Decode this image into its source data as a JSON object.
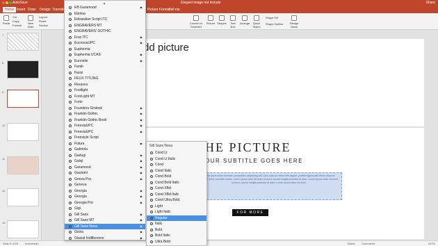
{
  "titlebar": {
    "app": "AutoSave",
    "doc": "Elegant image not include",
    "share": "Share"
  },
  "tabs": [
    "File",
    "Home",
    "Insert",
    "Draw",
    "Design",
    "Transitions",
    "Animations",
    "Slide Show",
    "Review",
    "View",
    "Tell me"
  ],
  "ribbon": {
    "paste": "Paste",
    "cut": "Cut",
    "copy": "Copy",
    "format": "Format",
    "new_slide": "New Slide",
    "layout": "Layout",
    "reset": "Reset",
    "section": "Section",
    "convert": "Convert to SmartArt",
    "picture": "Picture",
    "shapes": "Shapes",
    "textbox": "Text Box",
    "arrange": "Arrange",
    "quick_styles": "Quick Styles",
    "shape_fill": "Shape Fill",
    "shape_outline": "Shape Outline",
    "design_ideas": "Design Ideas",
    "picture_format": "Picture Format",
    "tell_me": "Tell me"
  },
  "thumbs": [
    "7",
    "8",
    "9",
    "10",
    "11",
    "12",
    "13"
  ],
  "slide1": {
    "title": "dd picture"
  },
  "slide2": {
    "title": "HE PICTURE",
    "subtitle": "OUR SUBTITLE GOES HERE",
    "body": "Lorem ipsum dolor sit amet, consectetur adipiscing elit. Quis nulla ac netus nibh aliquet, porttitor ligula justo libero vivamus porttitor dolor, convallis mattis. Lorem ipsum dolor sit amet, luctus in auctor fringilla pharetra at diam. Lorem ipsum dolor sit amet, luctus in auctor fringilla pharetra at diam. Lorem ipsum dolor sit amet.",
    "button": "FOR MORE"
  },
  "fontmenu": {
    "items": [
      {
        "label": "EB Garamond",
        "arrow": true
      },
      {
        "label": "Ebrima",
        "arrow": false
      },
      {
        "label": "Edwardian Script ITC",
        "arrow": false
      },
      {
        "label": "ENGRAVERS MT",
        "arrow": false
      },
      {
        "label": "ENGRAVERS' GOTHIC",
        "arrow": false
      },
      {
        "label": "Eras ITC",
        "arrow": true
      },
      {
        "label": "EucrosiaUPC",
        "arrow": true
      },
      {
        "label": "Euphemia",
        "arrow": false
      },
      {
        "label": "Euphemia UCAS",
        "arrow": true
      },
      {
        "label": "Eurostile",
        "arrow": true
      },
      {
        "label": "Farah",
        "arrow": false
      },
      {
        "label": "Farisi",
        "arrow": false
      },
      {
        "label": "FELIX TITLING",
        "arrow": false
      },
      {
        "label": "Fleurons",
        "arrow": false
      },
      {
        "label": "Footlight",
        "arrow": false
      },
      {
        "label": "ForeLight MT",
        "arrow": false
      },
      {
        "label": "Forte",
        "arrow": false
      },
      {
        "label": "Founders Grotesk",
        "arrow": true
      },
      {
        "label": "Franklin Gothic",
        "arrow": true
      },
      {
        "label": "Franklin Gothic Book",
        "arrow": true
      },
      {
        "label": "FreesiaUPC",
        "arrow": true
      },
      {
        "label": "FreesiaUPC",
        "arrow": true
      },
      {
        "label": "Freestyle Script",
        "arrow": false
      },
      {
        "label": "Futura",
        "arrow": true
      },
      {
        "label": "Gabriola",
        "arrow": false
      },
      {
        "label": "Gadugi",
        "arrow": true
      },
      {
        "label": "Galvji",
        "arrow": true
      },
      {
        "label": "Garamond",
        "arrow": true
      },
      {
        "label": "Gautami",
        "arrow": true
      },
      {
        "label": "Geeza Pro",
        "arrow": true
      },
      {
        "label": "Geneva",
        "arrow": false
      },
      {
        "label": "Georgia",
        "arrow": true
      },
      {
        "label": "Georgia",
        "arrow": true
      },
      {
        "label": "Georgia Pro",
        "arrow": true
      },
      {
        "label": "Gigi",
        "arrow": false
      },
      {
        "label": "Gill Sans",
        "arrow": true
      },
      {
        "label": "Gill Sans MT",
        "arrow": true
      },
      {
        "label": "Gill Sans Nova",
        "arrow": true,
        "highlight": true
      },
      {
        "label": "Gisha",
        "arrow": true
      },
      {
        "label": "Glacial Indifference",
        "arrow": true
      }
    ]
  },
  "submenu": {
    "header": "Gill Sans Nova",
    "items": [
      {
        "label": "Cond Lt"
      },
      {
        "label": "Cond Lt Italic"
      },
      {
        "label": "Cond"
      },
      {
        "label": "Cond Italic"
      },
      {
        "label": "Cond Bold"
      },
      {
        "label": "Cond Bold Italic"
      },
      {
        "label": "Cond XBd"
      },
      {
        "label": "Cond XBd Italic"
      },
      {
        "label": "Cond Ultra Bold"
      },
      {
        "label": "Light"
      },
      {
        "label": "Light Italic"
      },
      {
        "label": "Regular",
        "highlight": true
      },
      {
        "label": "Italic"
      },
      {
        "label": "Bold"
      },
      {
        "label": "Bold Italic"
      },
      {
        "label": "Ultra Bold"
      }
    ]
  },
  "status": {
    "slide": "Slide 9 of 20",
    "lang": "Indonesian",
    "notes": "Notes",
    "comments": "Comments",
    "zoom": "107%"
  }
}
